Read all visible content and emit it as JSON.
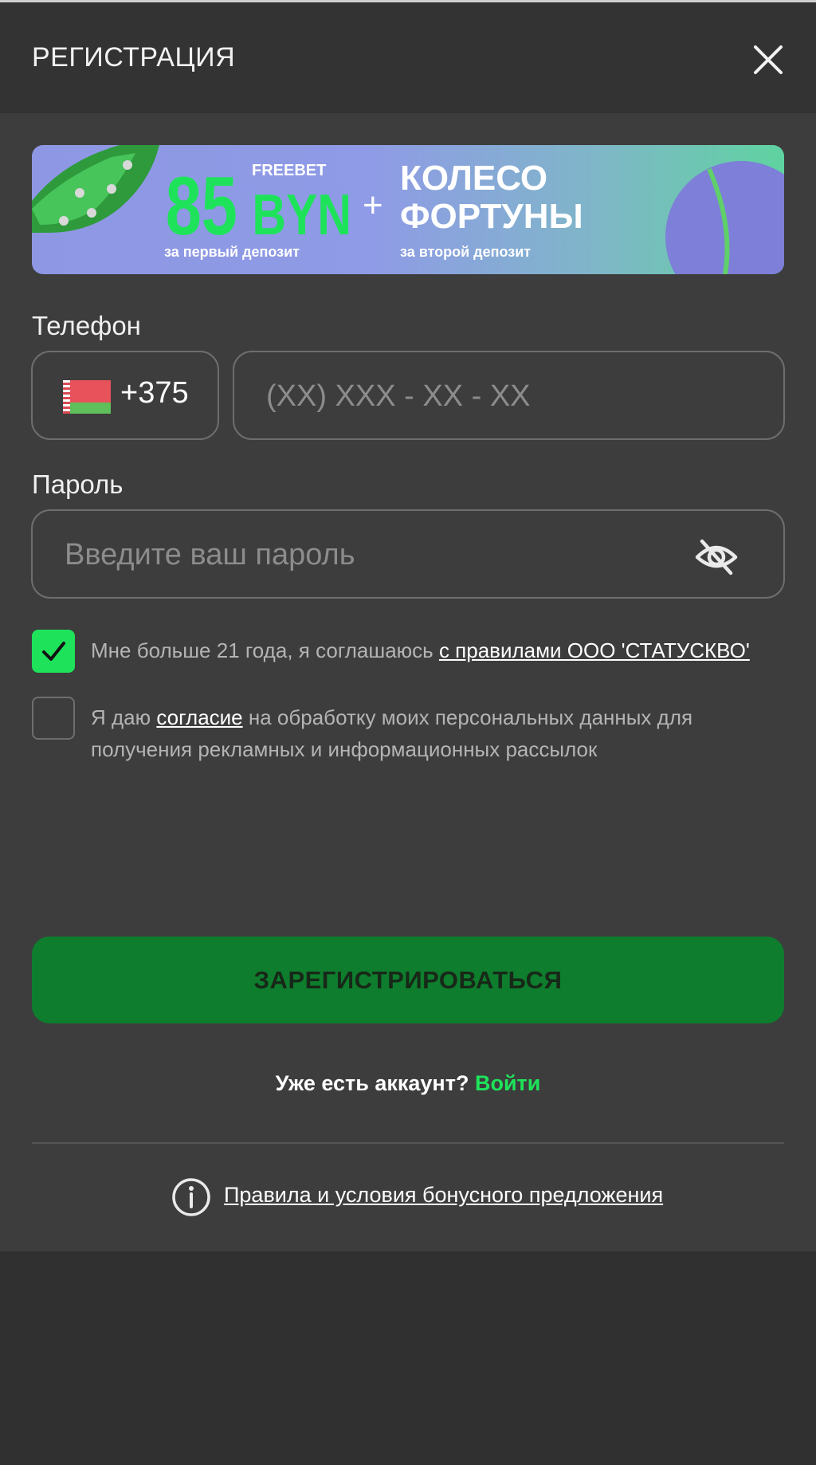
{
  "header": {
    "title": "РЕГИСТРАЦИЯ",
    "close_icon": "close-icon"
  },
  "banner": {
    "amount": "85",
    "freebet": "FREEBET",
    "currency": "BYN",
    "first_deposit": "за первый депозит",
    "plus": "+",
    "wheel_line1": "КОЛЕСО",
    "wheel_line2": "ФОРТУНЫ",
    "second_deposit": "за второй депозит"
  },
  "form": {
    "phone_label": "Телефон",
    "country_code": "+375",
    "country_flag": "belarus-flag-icon",
    "phone_placeholder": "(XX) XXX - XX - XX",
    "phone_value": "",
    "password_label": "Пароль",
    "password_placeholder": "Введите ваш пароль",
    "password_value": "",
    "password_toggle_icon": "eye-slash-icon",
    "age_checkbox": {
      "checked": true,
      "text": "Мне больше 21 года, я соглашаюсь ",
      "link": "с правилами ООО 'СТАТУСКВО'"
    },
    "consent_checkbox": {
      "checked": false,
      "text_before": "Я даю ",
      "link": "согласие",
      "text_after": " на обработку моих персональных данных для получения рекламных и информационных рассылок"
    },
    "submit_label": "ЗАРЕГИСТРИРОВАТЬСЯ"
  },
  "footer": {
    "have_account": "Уже есть аккаунт?",
    "login_link": "Войти",
    "bonus_terms": "Правила и условия бонусного предложения",
    "info_icon": "info-icon"
  },
  "colors": {
    "accent_green": "#1ee35a",
    "button_green": "#0e7d2d",
    "panel_bg": "#3d3d3d",
    "header_bg": "#333333"
  }
}
